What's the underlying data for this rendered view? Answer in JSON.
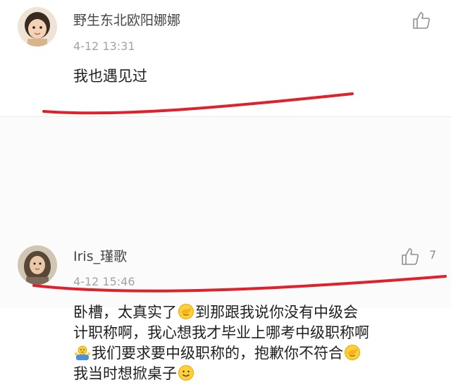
{
  "comments": [
    {
      "username": "野生东北欧阳娜娜",
      "time": "4-12 13:31",
      "text": "我也遇见过",
      "like_icon": "thumbs-up-outline-icon"
    },
    {
      "username": "Iris_瑾歌",
      "time": "4-12 15:46",
      "like_icon": "thumbs-up-outline-icon",
      "like_count": "7",
      "text_lines": [
        {
          "a": "卧槽，太真实了",
          "b": "到那跟我说你没有中级会"
        },
        {
          "a": "计职称啊，我心想我才毕业上哪考中级职称啊"
        },
        {
          "a": "我们要求要中级职称的，抱歉你不符合"
        },
        {
          "a": "我当时想掀桌子"
        }
      ],
      "emojis": [
        "facepalm-emoji",
        "shrug-emoji",
        "facepalm-emoji",
        "smile-emoji"
      ]
    }
  ],
  "colors": {
    "annotation_red": "#e0202a",
    "username": "#454545",
    "timestamp": "#a3a3a3"
  }
}
